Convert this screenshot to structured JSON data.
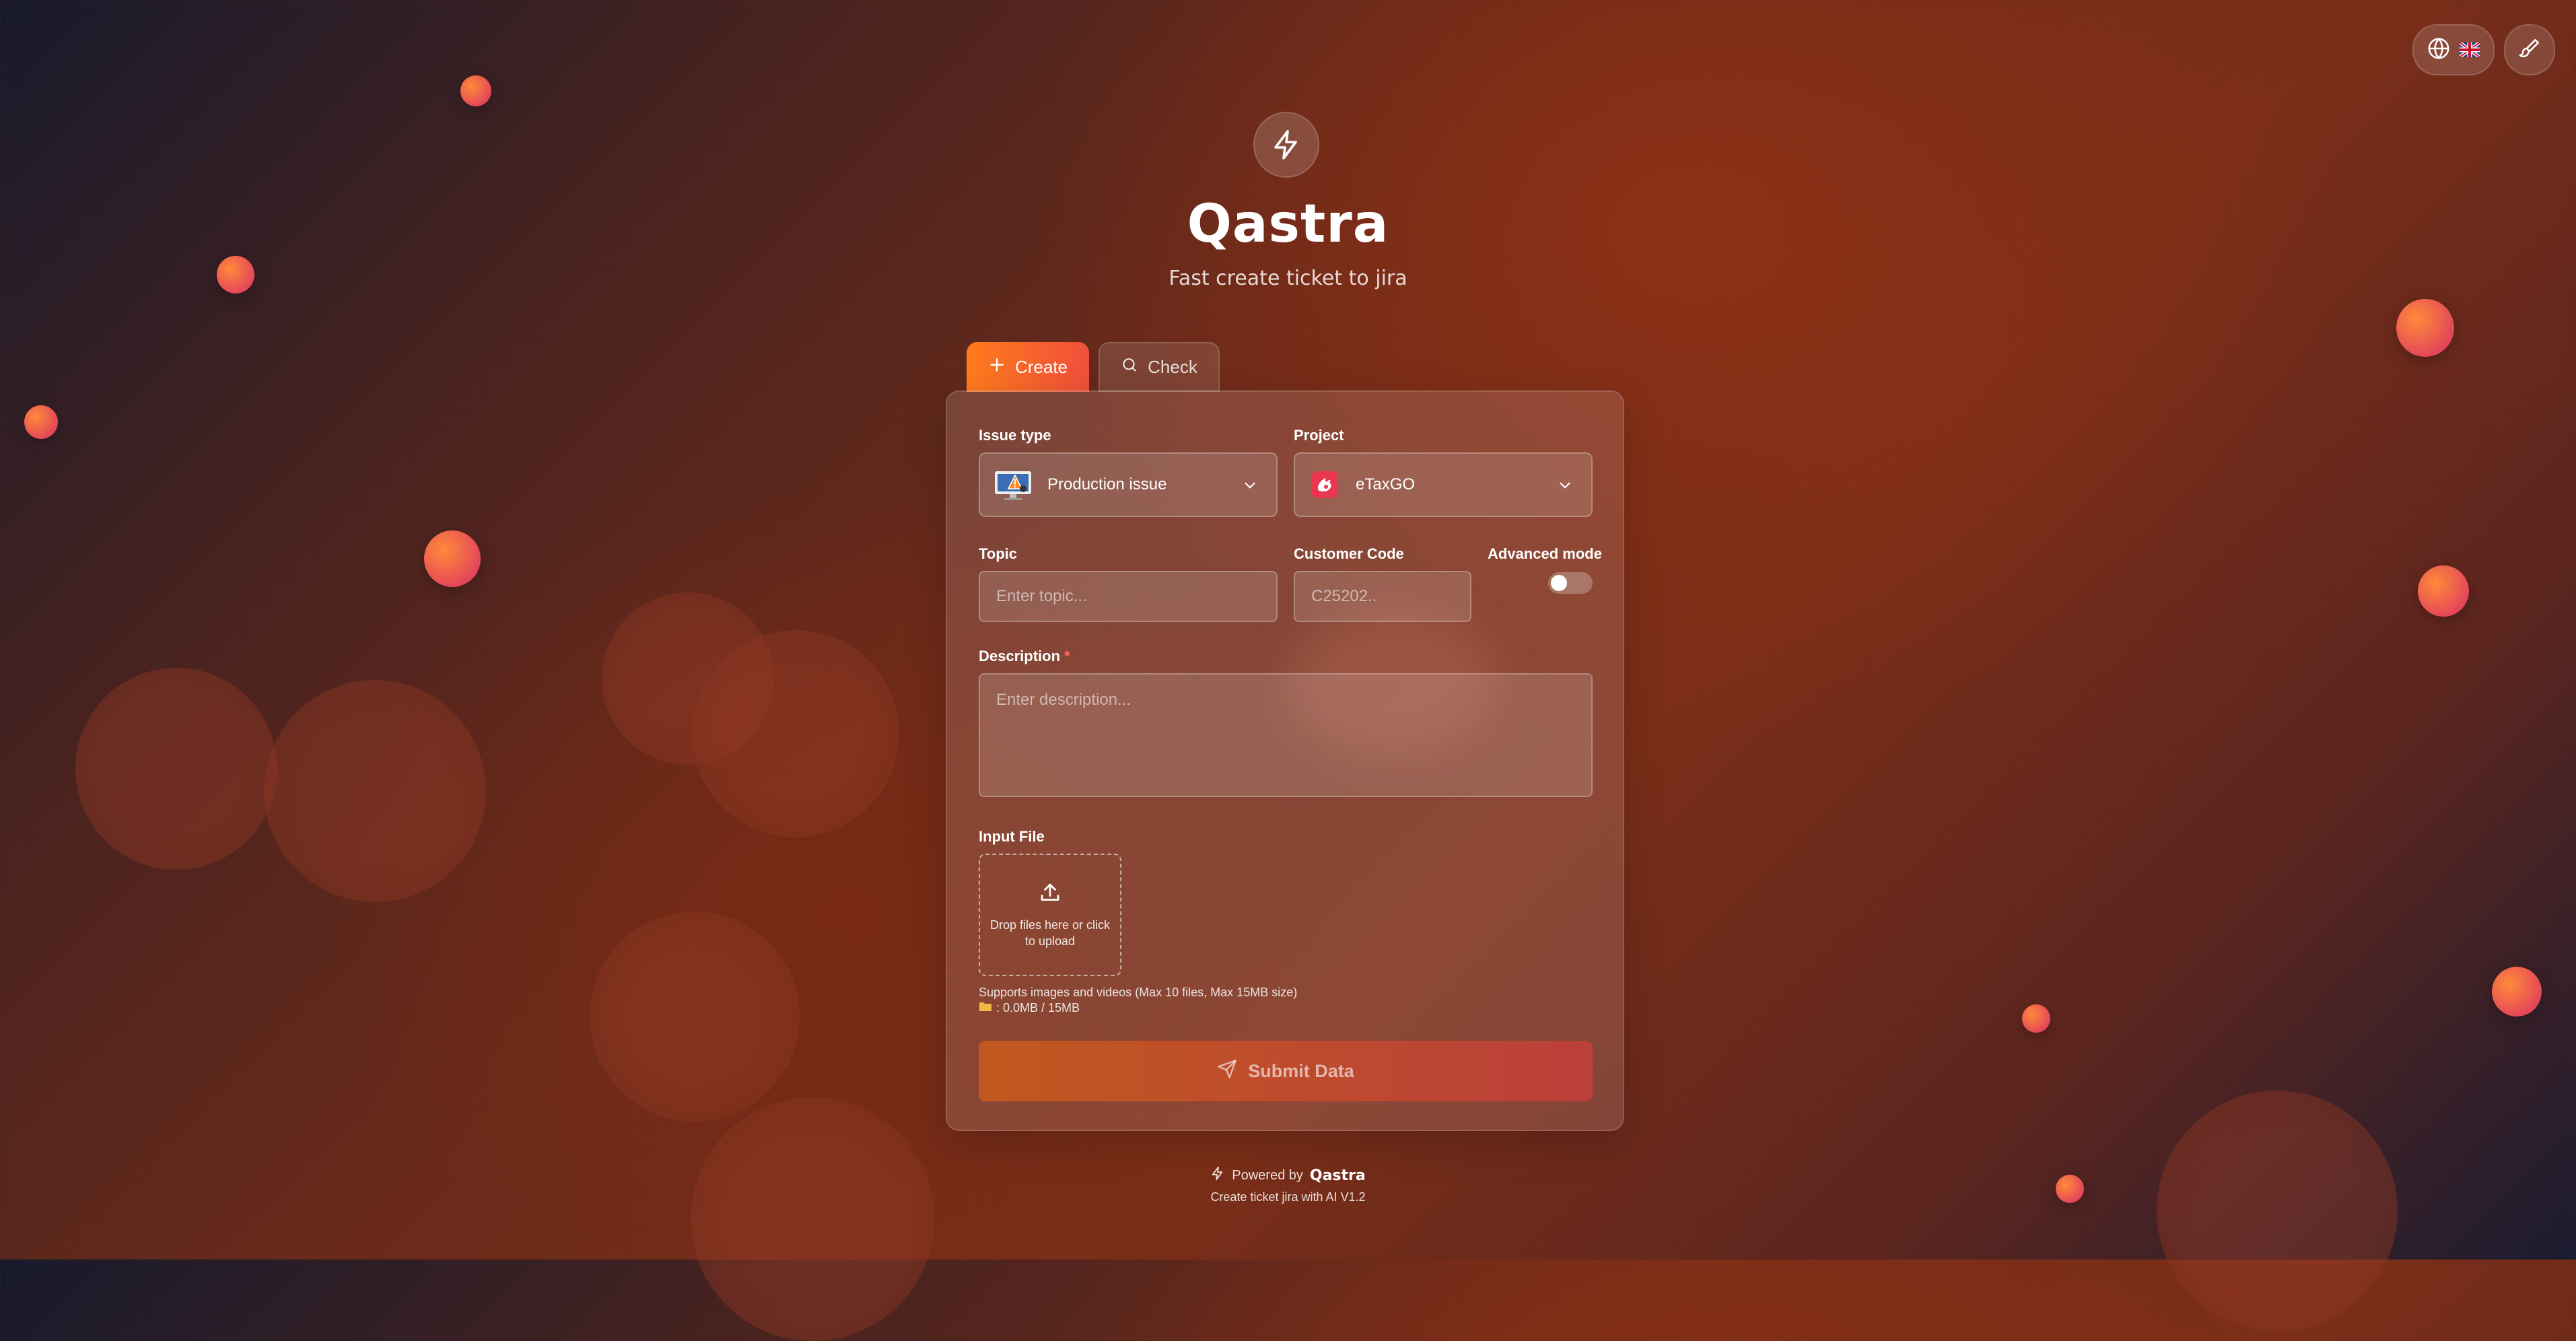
{
  "app": {
    "title": "Qastra",
    "tagline": "Fast create ticket to jira"
  },
  "topbar": {
    "language_flag": "🇬🇧",
    "language_icon": "globe-icon",
    "theme_icon": "paintbrush-icon"
  },
  "tabs": [
    {
      "label": "Create",
      "icon": "plus-icon",
      "active": true
    },
    {
      "label": "Check",
      "icon": "search-icon",
      "active": false
    }
  ],
  "form": {
    "issue_type": {
      "label": "Issue type",
      "value": "Production issue",
      "icon": "production-issue-icon"
    },
    "project": {
      "label": "Project",
      "value": "eTaxGO",
      "icon": "etaxgo-project-icon"
    },
    "topic": {
      "label": "Topic",
      "placeholder": "Enter topic..."
    },
    "customer_code": {
      "label": "Customer Code",
      "placeholder": "C25202.."
    },
    "advanced_mode": {
      "label": "Advanced mode",
      "enabled": false
    },
    "description": {
      "label": "Description",
      "required_mark": "*",
      "placeholder": "Enter description..."
    },
    "file": {
      "label": "Input File",
      "dropzone_text": "Drop files here or click to upload",
      "support_text": "Supports images and videos (Max 10 files, Max 15MB size)",
      "usage_text": ": 0.0MB / 15MB"
    },
    "submit_label": "Submit Data"
  },
  "footer": {
    "powered_by": "Powered by",
    "brand": "Qastra",
    "note": "Create ticket jira with AI V1.2"
  },
  "colors": {
    "accent_orange": "#ff7b1c",
    "accent_red": "#ef4f3a"
  }
}
